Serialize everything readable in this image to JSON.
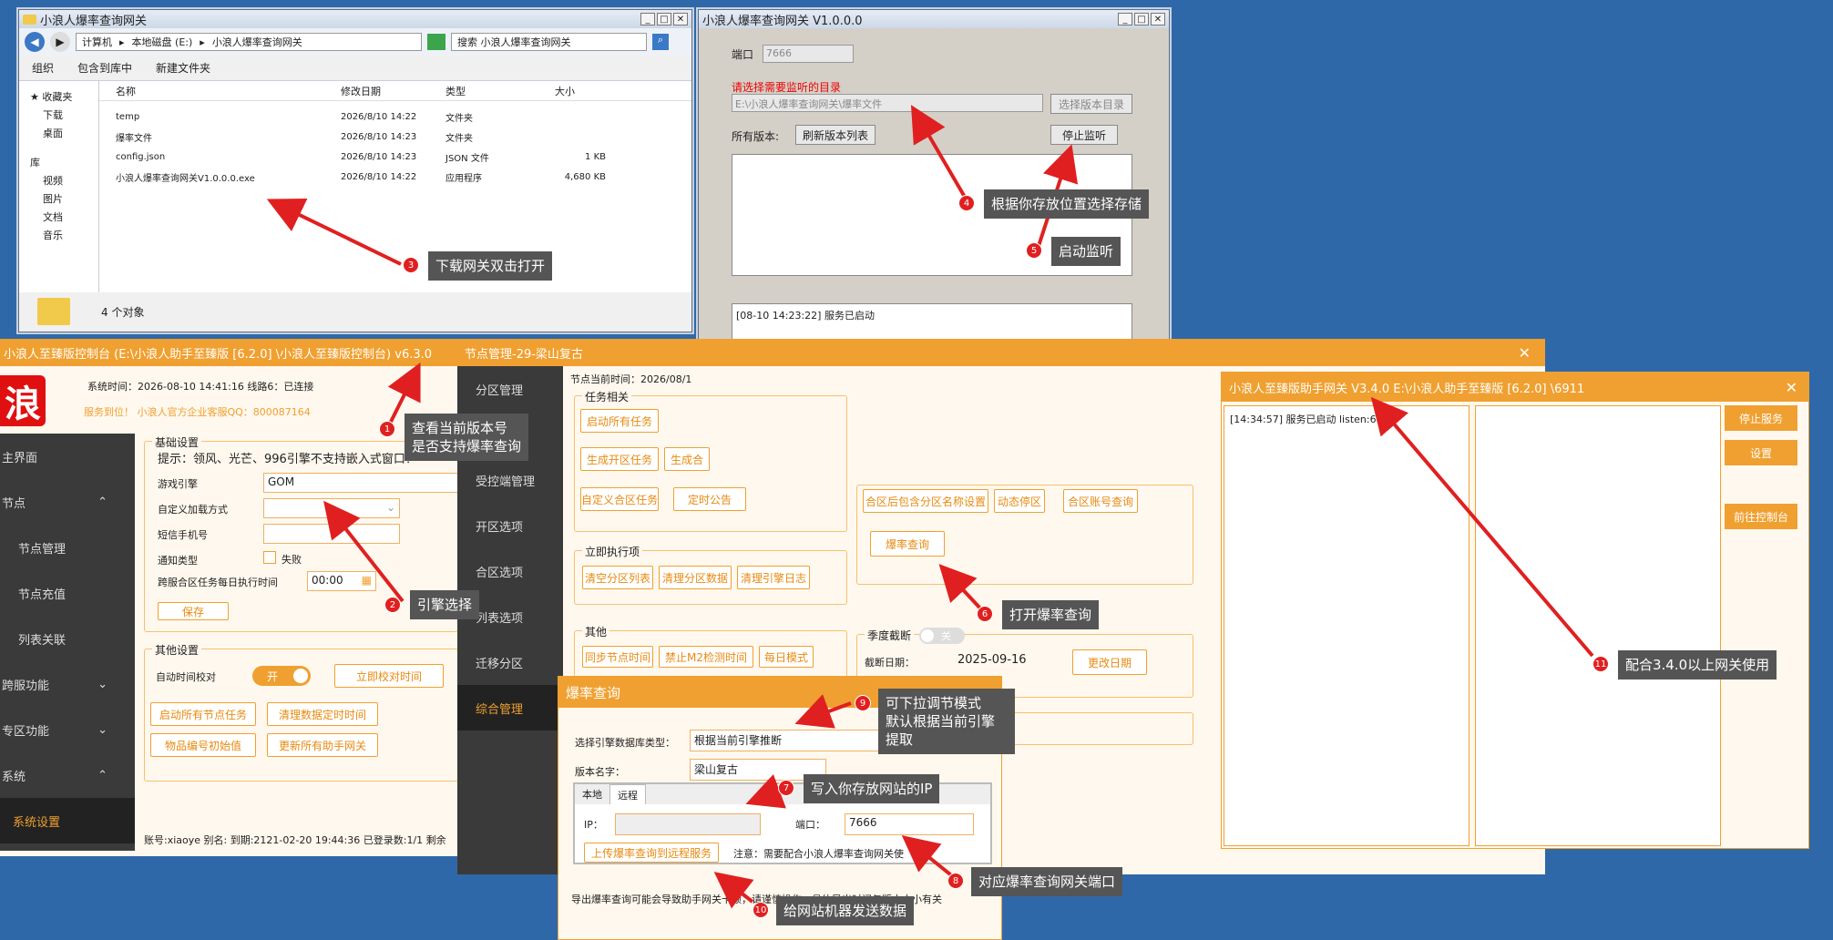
{
  "explorer": {
    "title": "小浪人爆率查询网关",
    "path": [
      "计算机",
      "本地磁盘 (E:)",
      "小浪人爆率查询网关"
    ],
    "search": "搜索 小浪人爆率查询网关",
    "toolbar": [
      "组织",
      "包含到库中",
      "新建文件夹"
    ],
    "cols": [
      "名称",
      "修改日期",
      "类型",
      "大小"
    ],
    "tree": [
      "收藏夹",
      "下载",
      "桌面",
      "库",
      "视频",
      "图片",
      "文档",
      "音乐"
    ],
    "rows": [
      [
        "temp",
        "2026/8/10 14:22",
        "文件夹",
        ""
      ],
      [
        "爆率文件",
        "2026/8/10 14:23",
        "文件夹",
        ""
      ],
      [
        "config.json",
        "2026/8/10 14:23",
        "JSON 文件",
        "1 KB"
      ],
      [
        "小浪人爆率查询网关V1.0.0.0.exe",
        "2026/8/10 14:22",
        "应用程序",
        "4,680 KB"
      ]
    ],
    "status": "4 个对象"
  },
  "gateway": {
    "title": "小浪人爆率查询网关 V1.0.0.0",
    "port_label": "端口",
    "port": "7666",
    "dir_label": "请选择需要监听的目录",
    "dir": "E:\\小浪人爆率查询网关\\爆率文件",
    "choose": "选择版本目录",
    "versions": "所有版本:",
    "refresh": "刷新版本列表",
    "stop": "停止监听",
    "log": "[08-10 14:23:22] 服务已启动"
  },
  "console": {
    "title": "小浪人至臻版控制台 (E:\\小浪人助手至臻版 [6.2.0] \\小浪人至臻版控制台) v6.3.0",
    "logo": "浪",
    "systime": "系统时间：2026-08-10 14:41:16  线路6：已连接",
    "notice": "服务到位！     小浪人官方企业客服QQ：800087164",
    "nav": [
      "主界面",
      "节点",
      "节点管理",
      "节点充值",
      "列表关联",
      "跨服功能",
      "专区功能",
      "系统",
      "系统设置"
    ],
    "basic": "基础设置",
    "tip": "提示：领风、光芒、996引擎不支持嵌入式窗口！",
    "engine_label": "游戏引擎",
    "engine": "GOM",
    "custom_load": "自定义加载方式",
    "sms": "短信手机号",
    "notify": "通知类型",
    "fail": "失败",
    "cross": "跨服合区任务每日执行时间",
    "time": "00:00",
    "save": "保存",
    "other": "其他设置",
    "autotime": "自动时间校对",
    "on": "开",
    "verify": "立即校对时间",
    "b1": "启动所有节点任务",
    "b2": "清理数据定时时间",
    "b3": "物品编号初始值",
    "b4": "更新所有助手网关",
    "footer": "账号:xiaoye 别名: 到期:2121-02-20 19:44:36 已登录数:1/1 剩余"
  },
  "node": {
    "title": "节点管理-29-梁山复古",
    "time": "节点当前时间：2026/08/1",
    "nav": [
      "分区管理",
      "",
      "受控端管理",
      "开区选项",
      "合区选项",
      "列表选项",
      "迁移分区",
      "综合管理"
    ],
    "task": "任务相关",
    "t1": "启动所有任务",
    "t2": "生成开区任务",
    "t3": "生成合",
    "t4": "自定义合区任务",
    "t5": "定时公告",
    "r1": "合区后包含分区名称设置",
    "r2": "动态停区",
    "r3": "合区账号查询",
    "drop": "爆率查询",
    "immediate": "立即执行项",
    "i1": "清空分区列表",
    "i2": "清理分区数据",
    "i3": "清理引擎日志",
    "other": "其他",
    "o1": "同步节点时间",
    "o2": "禁止M2检测时间",
    "o3": "每日模式",
    "season": "季度截断",
    "off": "关",
    "cutdate": "截断日期：",
    "date": "2025-09-16",
    "change": "更改日期"
  },
  "query": {
    "title": "爆率查询",
    "engine_type": "选择引擎数据库类型：",
    "engine_val": "根据当前引擎推断",
    "version": "版本名字：",
    "version_val": "梁山复古",
    "tab_local": "本地",
    "tab_remote": "远程",
    "ip": "IP：",
    "port": "端口：",
    "port_val": "7666",
    "upload": "上传爆率查询到远程服务",
    "note": "注意：需要配合小浪人爆率查询网关使",
    "warn": "导出爆率查询可能会导致助手网关卡顿，请谨慎操作，具体导出时间与版本大小有关"
  },
  "helper": {
    "title": "小浪人至臻版助手网关 V3.4.0  E:\\小浪人助手至臻版 [6.2.0] \\6911",
    "log": "[14:34:57] 服务已启动 listen:6911",
    "b1": "停止服务",
    "b2": "设置",
    "b3": "前往控制台"
  },
  "callouts": [
    {
      "n": "1",
      "text": "查看当前版本号\n是否支持爆率查询"
    },
    {
      "n": "2",
      "text": "引擎选择"
    },
    {
      "n": "3",
      "text": "下载网关双击打开"
    },
    {
      "n": "4",
      "text": "根据你存放位置选择存储"
    },
    {
      "n": "5",
      "text": "启动监听"
    },
    {
      "n": "6",
      "text": "打开爆率查询"
    },
    {
      "n": "7",
      "text": "写入你存放网站的IP"
    },
    {
      "n": "8",
      "text": "对应爆率查询网关端口"
    },
    {
      "n": "9",
      "text": "可下拉调节模式\n默认根据当前引擎\n提取"
    },
    {
      "n": "10",
      "text": "给网站机器发送数据"
    },
    {
      "n": "11",
      "text": "配合3.4.0以上网关使用"
    }
  ],
  "colors": {
    "accent": "#f0a030",
    "desktop": "#2f68a8",
    "arrow": "#e02020"
  }
}
